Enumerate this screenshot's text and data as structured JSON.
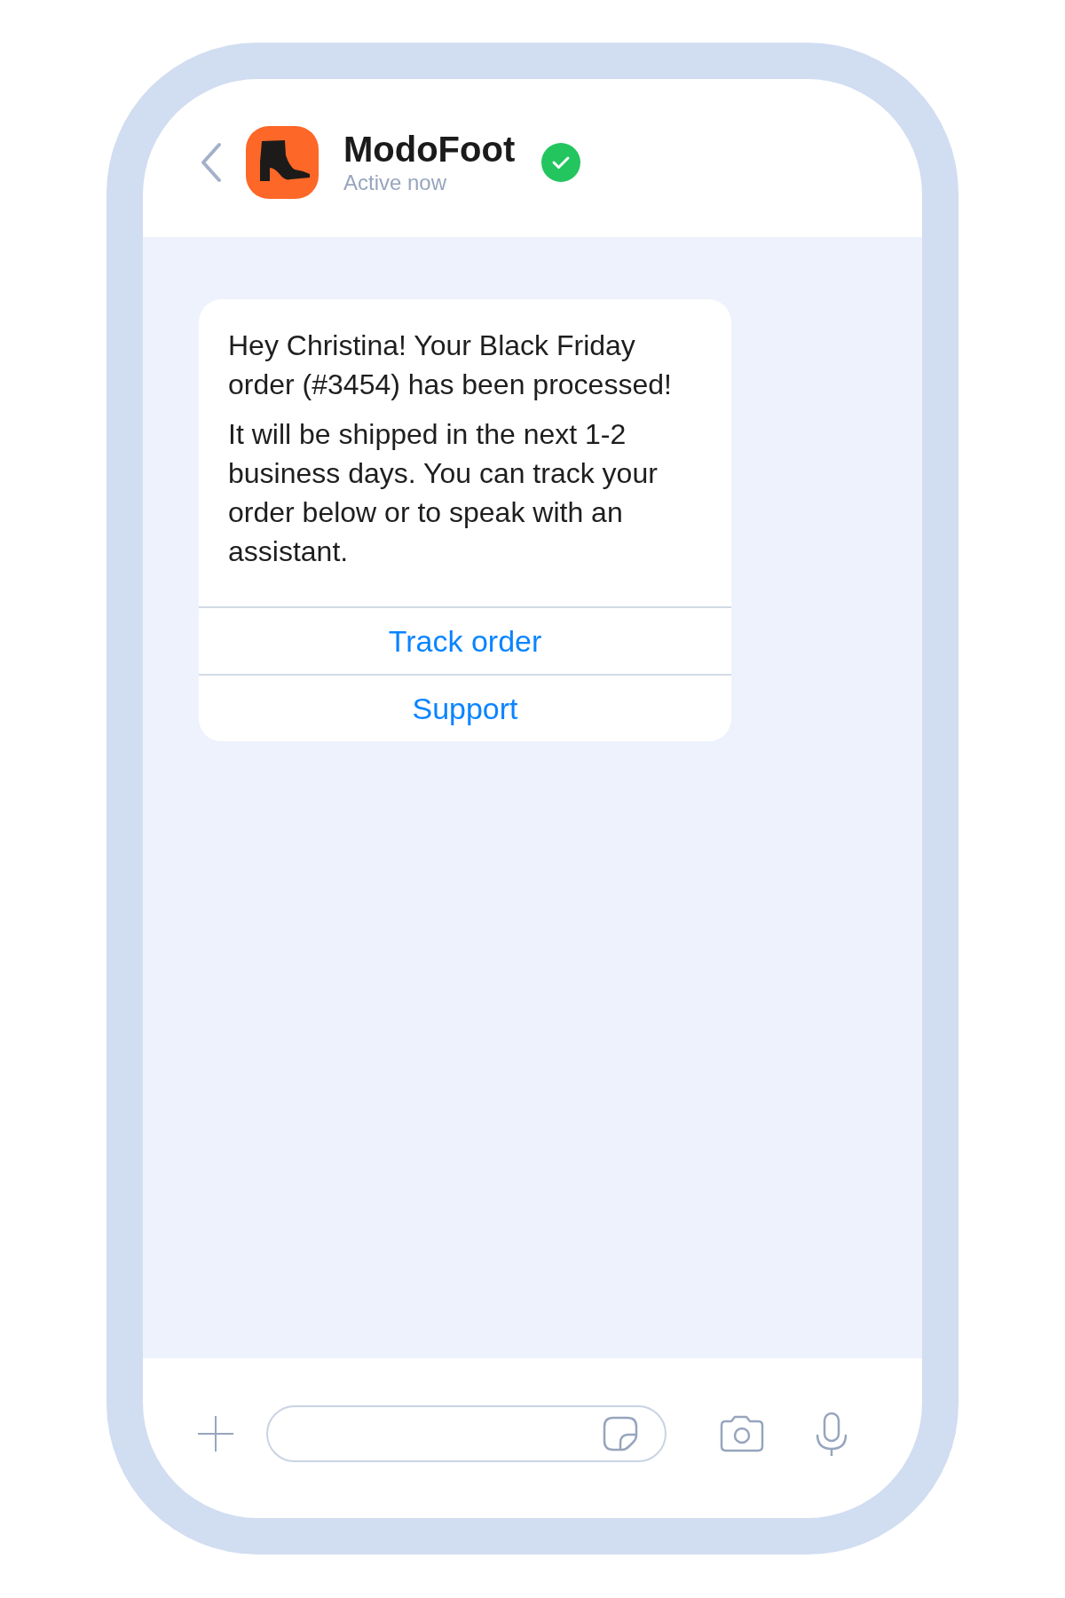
{
  "header": {
    "title": "ModoFoot",
    "status": "Active now",
    "verified": true
  },
  "message": {
    "paragraphs": [
      "Hey Christina! Your Black Friday order (#3454) has been processed!",
      "It will be shipped in the next 1-2 business days. You can track your order below or to speak with an assistant."
    ],
    "buttons": [
      "Track order",
      "Support"
    ]
  }
}
